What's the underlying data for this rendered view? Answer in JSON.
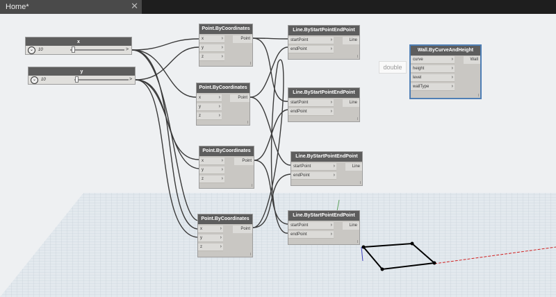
{
  "tab": {
    "label": "Home*",
    "close_glyph": "✕"
  },
  "sliders": [
    {
      "title": "x",
      "value": "10",
      "toggle_glyph": "⌄",
      "out_glyph": ">"
    },
    {
      "title": "y",
      "value": "10",
      "toggle_glyph": "⌄",
      "out_glyph": ">"
    }
  ],
  "point_nodes": [
    {
      "title": "Point.ByCoordinates",
      "inputs": [
        "x",
        "y",
        "z"
      ],
      "output": "Point",
      "footer": "l"
    },
    {
      "title": "Point.ByCoordinates",
      "inputs": [
        "x",
        "y",
        "z"
      ],
      "output": "Point",
      "footer": "l"
    },
    {
      "title": "Point.ByCoordinates",
      "inputs": [
        "x",
        "y",
        "z"
      ],
      "output": "Point",
      "footer": "l"
    },
    {
      "title": "Point.ByCoordinates",
      "inputs": [
        "x",
        "y",
        "z"
      ],
      "output": "Point",
      "footer": "l"
    }
  ],
  "line_nodes": [
    {
      "title": "Line.ByStartPointEndPoint",
      "inputs": [
        "startPoint",
        "endPoint"
      ],
      "output": "Line",
      "footer": "l"
    },
    {
      "title": "Line.ByStartPointEndPoint",
      "inputs": [
        "startPoint",
        "endPoint"
      ],
      "output": "Line",
      "footer": "l"
    },
    {
      "title": "Line.ByStartPointEndPoint",
      "inputs": [
        "startPoint",
        "endPoint"
      ],
      "output": "Line",
      "footer": "l"
    },
    {
      "title": "Line.ByStartPointEndPoint",
      "inputs": [
        "startPoint",
        "endPoint"
      ],
      "output": "Line",
      "footer": "l"
    }
  ],
  "wall_node": {
    "title": "Wall.ByCurveAndHeight",
    "inputs": [
      "curve",
      "height",
      "level",
      "wallType"
    ],
    "output": "Wall",
    "footer": "l"
  },
  "double_label": "double",
  "chevron_glyph": "›",
  "colors": {
    "node_header": "#5d5d5d",
    "node_body": "#c9c7c3",
    "wall_border": "#4f7fb5",
    "tab_bg": "#4a4a4a"
  }
}
